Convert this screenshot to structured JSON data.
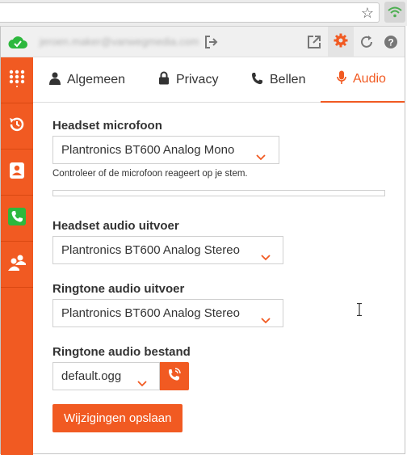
{
  "browser": {
    "icons": [
      "star-icon",
      "wifi-icon"
    ]
  },
  "topbar": {
    "account_email": "jeroen.maker@vanwegmedia.com",
    "icons": [
      "cloud-icon",
      "logout-icon",
      "popout-icon",
      "gear-icon",
      "refresh-icon",
      "help-icon"
    ]
  },
  "sidebar": {
    "items": [
      "dialpad-icon",
      "history-icon",
      "contacts-icon",
      "phone-icon",
      "group-icon"
    ]
  },
  "tabs": [
    {
      "label": "Algemeen",
      "icon": "user-icon"
    },
    {
      "label": "Privacy",
      "icon": "lock-icon"
    },
    {
      "label": "Bellen",
      "icon": "phone-icon"
    },
    {
      "label": "Audio",
      "icon": "microphone-icon",
      "active": true
    }
  ],
  "form": {
    "mic": {
      "label": "Headset microfoon",
      "value": "Plantronics BT600 Analog Mono",
      "hint": "Controleer of de microfoon reageert op je stem.",
      "level": 0
    },
    "output": {
      "label": "Headset audio uitvoer",
      "value": "Plantronics BT600 Analog Stereo"
    },
    "ringtone_output": {
      "label": "Ringtone audio uitvoer",
      "value": "Plantronics BT600 Analog Stereo"
    },
    "ringtone_file": {
      "label": "Ringtone audio bestand",
      "value": "default.ogg"
    },
    "save_label": "Wijzigingen opslaan"
  },
  "colors": {
    "accent": "#f15a22",
    "active_green": "#2db83d"
  }
}
